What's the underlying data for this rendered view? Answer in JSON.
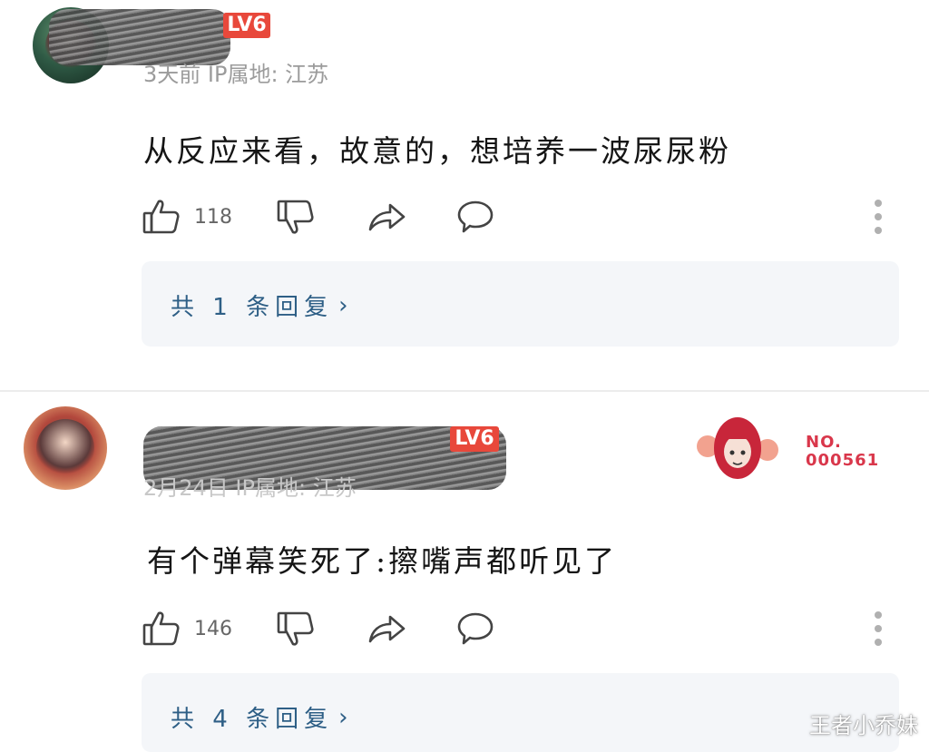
{
  "comments": [
    {
      "level": "LV6",
      "meta": "3天前 IP属地: 江苏",
      "text": "从反应来看，故意的，想培养一波尿尿粉",
      "likes": "118",
      "replies_label": "共 1 条回复",
      "replies_chevron": "›"
    },
    {
      "level": "LV6",
      "meta": "2月24日 IP属地: 江苏",
      "text": "有个弹幕笑死了:擦嘴声都听见了",
      "likes": "146",
      "replies_label": "共 4 条回复",
      "replies_chevron": "›",
      "badge": {
        "line1": "NO.",
        "line2": "000561"
      }
    }
  ],
  "icons": {
    "like": "thumbs-up-icon",
    "dislike": "thumbs-down-icon",
    "share": "share-arrow-icon",
    "reply": "speech-bubble-icon",
    "more": "vertical-dots-icon"
  },
  "colors": {
    "level_badge": "#e8483b",
    "reply_link": "#2e5f86",
    "badge_no": "#d9374b"
  },
  "watermark": "王者小乔妹"
}
